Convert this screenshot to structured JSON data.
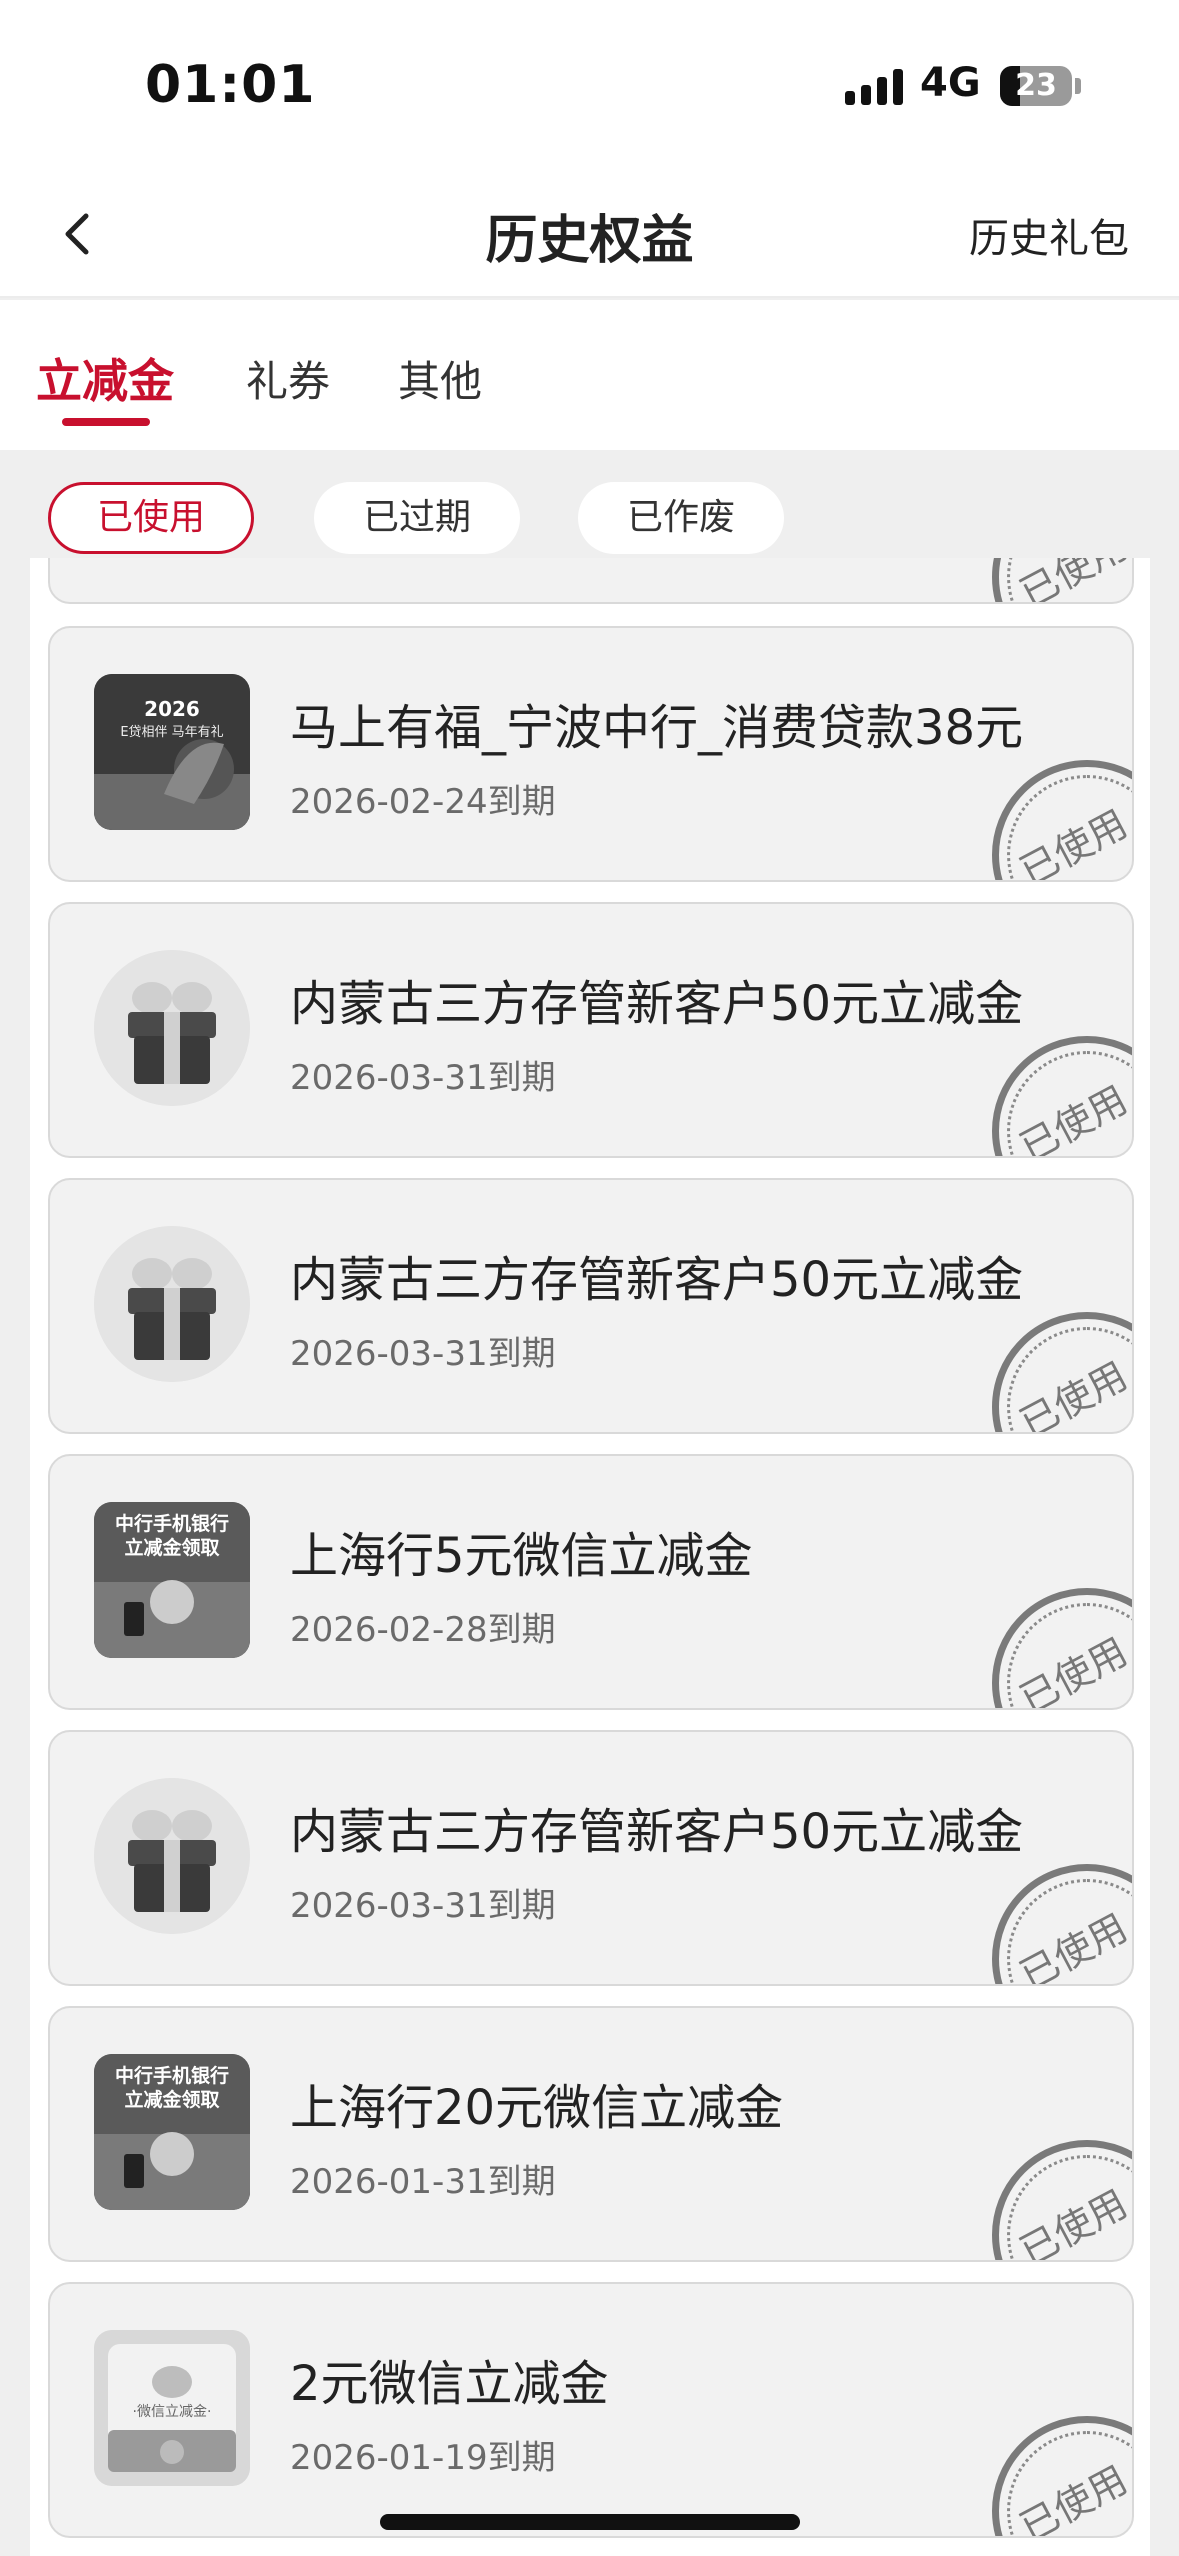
{
  "status_bar": {
    "time": "01:01",
    "network": "4G",
    "battery": "23"
  },
  "nav": {
    "title": "历史权益",
    "right_link": "历史礼包"
  },
  "tabs": [
    "立减金",
    "礼券",
    "其他"
  ],
  "filters": [
    "已使用",
    "已过期",
    "已作废"
  ],
  "stamp_label": "已使用",
  "items": [
    {
      "title": "马上有福_宁波中行_消费贷款38元",
      "date": "2026-02-24到期",
      "icon": "bank-poster-thumbnail",
      "thumb_text": [
        "2026",
        "E贷相伴 马年有礼"
      ]
    },
    {
      "title": "内蒙古三方存管新客户50元立减金",
      "date": "2026-03-31到期",
      "icon": "gift-box-icon"
    },
    {
      "title": "内蒙古三方存管新客户50元立减金",
      "date": "2026-03-31到期",
      "icon": "gift-box-icon"
    },
    {
      "title": "上海行5元微信立减金",
      "date": "2026-02-28到期",
      "icon": "mobile-bank-promo-thumbnail",
      "thumb_text": [
        "中行手机银行",
        "立减金领取"
      ]
    },
    {
      "title": "内蒙古三方存管新客户50元立减金",
      "date": "2026-03-31到期",
      "icon": "gift-box-icon"
    },
    {
      "title": "上海行20元微信立减金",
      "date": "2026-01-31到期",
      "icon": "mobile-bank-promo-thumbnail",
      "thumb_text": [
        "中行手机银行",
        "立减金领取"
      ]
    },
    {
      "title": "2元微信立减金",
      "date": "2026-01-19到期",
      "icon": "wechat-voucher-icon",
      "thumb_text": [
        "·微信立减金·"
      ]
    }
  ]
}
